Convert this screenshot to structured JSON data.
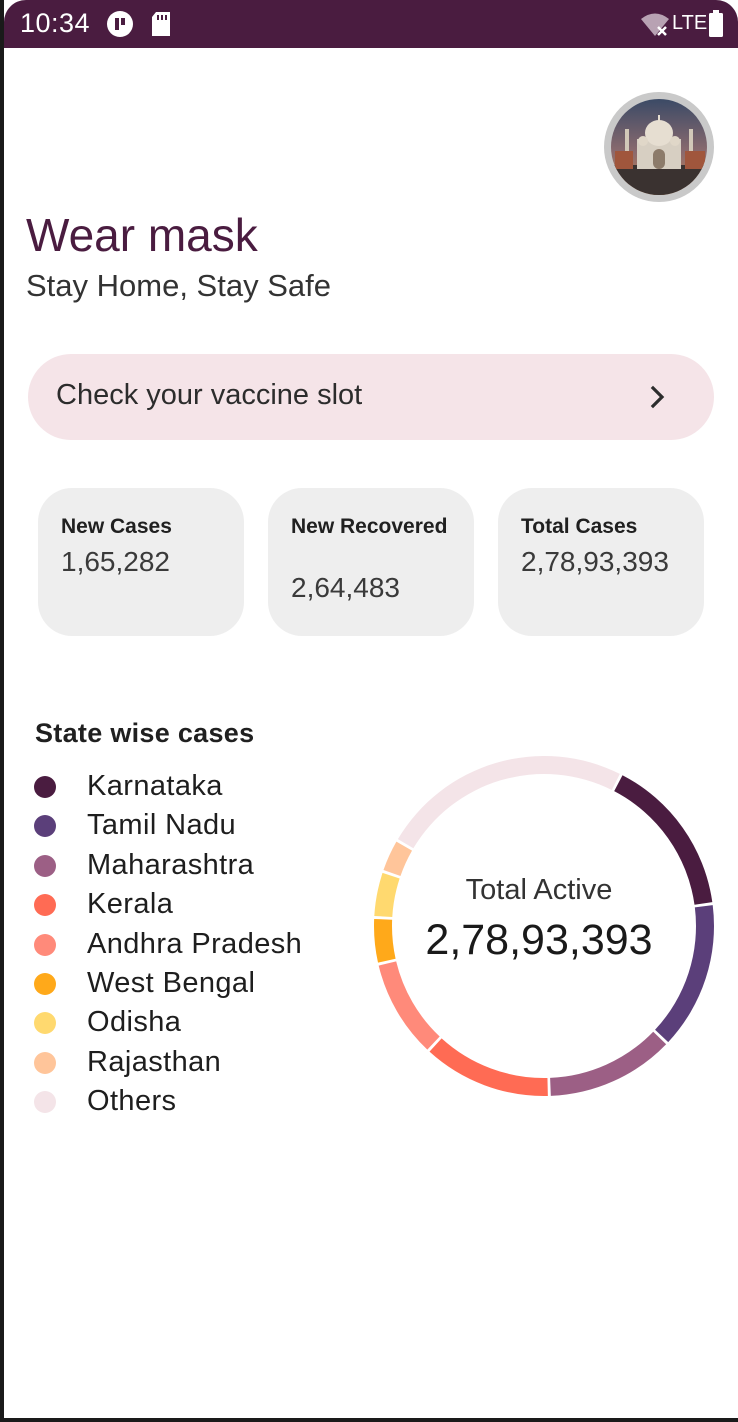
{
  "status_bar": {
    "time": "10:34",
    "network": "LTE",
    "icons": [
      "app-notification-icon",
      "sd-card-icon",
      "wifi-off-icon",
      "battery-icon"
    ]
  },
  "header": {
    "title": "Wear mask",
    "subtitle": "Stay Home, Stay Safe",
    "avatar": "taj-mahal-avatar-image"
  },
  "vaccine_slot": {
    "label": "Check your vaccine slot",
    "icon": "chevron-right-icon"
  },
  "stats": [
    {
      "title": "New Cases",
      "value": "1,65,282"
    },
    {
      "title": "New Recovered",
      "value": "2,64,483"
    },
    {
      "title": "Total Cases",
      "value": "2,78,93,393"
    }
  ],
  "section_title": "State wise cases",
  "chart_data": {
    "type": "pie",
    "variant": "donut",
    "center_label": "Total Active",
    "center_value": "2,78,93,393",
    "categories": [
      "Karnataka",
      "Tamil Nadu",
      "Maharashtra",
      "Kerala",
      "Andhra Pradesh",
      "West Bengal",
      "Odisha",
      "Rajasthan",
      "Others"
    ],
    "values": [
      15.4,
      14.2,
      12.4,
      12.4,
      9.5,
      4.4,
      4.4,
      3.2,
      24.1
    ],
    "colors": [
      "#4a1c40",
      "#5b3f7a",
      "#9c5f85",
      "#ff6b54",
      "#ff8a7a",
      "#ffa91a",
      "#ffd96f",
      "#ffc59a",
      "#f4e4e8"
    ],
    "legend_position": "left"
  },
  "colors": {
    "primary": "#4a1c40",
    "vaccine_bg": "#f5e4e8",
    "card_bg": "#eeeeee"
  }
}
